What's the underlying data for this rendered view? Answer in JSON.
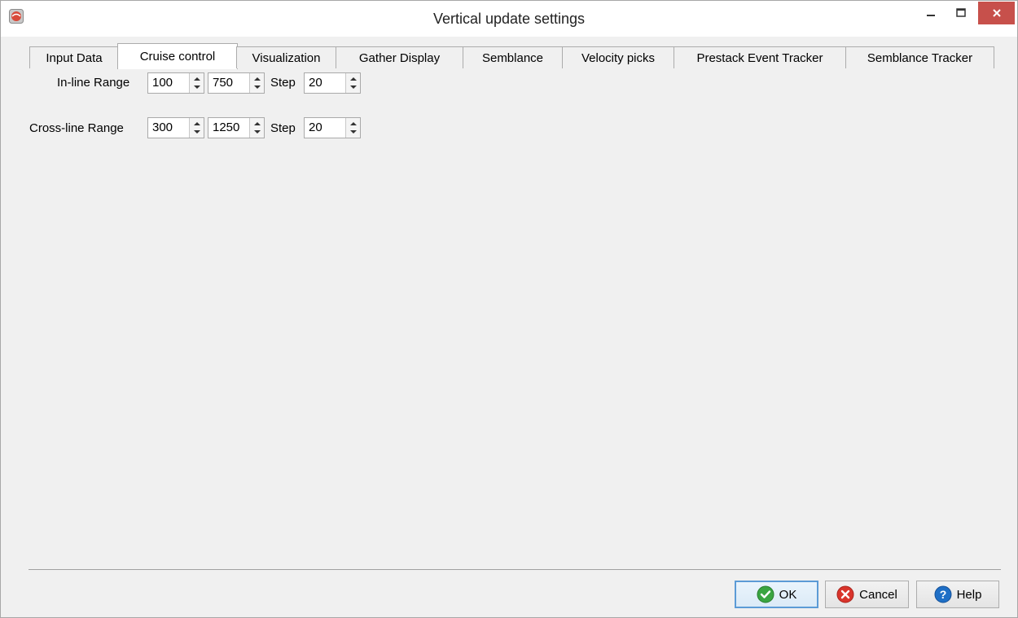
{
  "window": {
    "title": "Vertical update settings",
    "app_icon": "app-logo-icon",
    "controls": [
      "minimize-icon",
      "maximize-icon",
      "close-icon"
    ]
  },
  "tabs": [
    {
      "label": "Input Data",
      "active": false
    },
    {
      "label": "Cruise control",
      "active": true
    },
    {
      "label": "Visualization",
      "active": false
    },
    {
      "label": "Gather Display",
      "active": false
    },
    {
      "label": "Semblance",
      "active": false
    },
    {
      "label": "Velocity picks",
      "active": false
    },
    {
      "label": "Prestack Event Tracker",
      "active": false
    },
    {
      "label": "Semblance Tracker",
      "active": false
    }
  ],
  "cruise_control": {
    "inline": {
      "label": "In-line Range",
      "from": "100",
      "to": "750",
      "step_label": "Step",
      "step": "20"
    },
    "crossline": {
      "label": "Cross-line Range",
      "from": "300",
      "to": "1250",
      "step_label": "Step",
      "step": "20"
    }
  },
  "buttons": {
    "ok": "OK",
    "cancel": "Cancel",
    "help": "Help"
  },
  "colors": {
    "close_button": "#c7504b",
    "ok_icon": "#3aa541",
    "cancel_icon": "#d9342b",
    "help_icon": "#1f6fc6",
    "default_button_border": "#5c9bd6"
  }
}
